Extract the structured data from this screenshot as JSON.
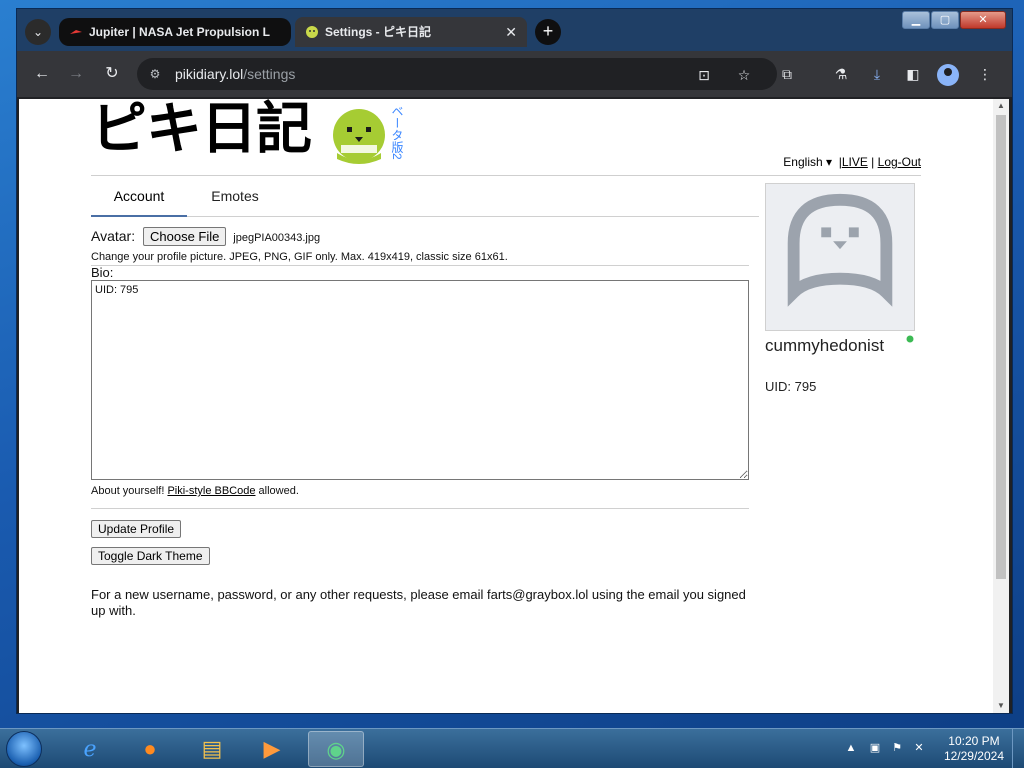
{
  "browser": {
    "tabs": [
      {
        "title": "Jupiter | NASA Jet Propulsion L",
        "favicon": "nasa-jpl-icon",
        "active": false
      },
      {
        "title": "Settings - ピキ日記",
        "favicon": "piki-mascot-icon",
        "active": true
      }
    ],
    "close_glyph": "✕",
    "new_tab_glyph": "+",
    "address": {
      "host": "pikidiary.lol",
      "path": "/settings"
    }
  },
  "site": {
    "logo_text": "ピキ日記",
    "beta_label": "ベータ版2",
    "language": "English",
    "live_link": "LIVE",
    "logout_link": "Log-Out",
    "tabs": [
      "Account",
      "Emotes"
    ],
    "avatar_label": "Avatar:",
    "choose_file": "Choose File",
    "file_name": "jpegPIA00343.jpg",
    "avatar_hint": "Change your profile picture. JPEG, PNG, GIF only. Max. 419x419, classic size 61x61.",
    "bio_label": "Bio:",
    "bio_value": "UID: 795",
    "bio_hint_prefix": "About yourself!",
    "bio_hint_link": "Piki-style BBCode",
    "bio_hint_suffix": "allowed.",
    "update_button": "Update Profile",
    "dark_theme_button": "Toggle Dark Theme",
    "note": "For a new username, password, or any other requests, please email farts@graybox.lol using the email you signed up with.",
    "profile": {
      "username": "cummyhedonist",
      "uid": "UID: 795"
    }
  },
  "taskbar": {
    "apps": [
      "internet-explorer-icon",
      "firefox-icon",
      "file-explorer-icon",
      "media-player-icon",
      "chrome-icon"
    ],
    "time": "10:20 PM",
    "date": "12/29/2024"
  },
  "colors": {
    "accent": "#4a6fa5",
    "mascot": "#a6cc33",
    "beta": "#3a86ff"
  }
}
